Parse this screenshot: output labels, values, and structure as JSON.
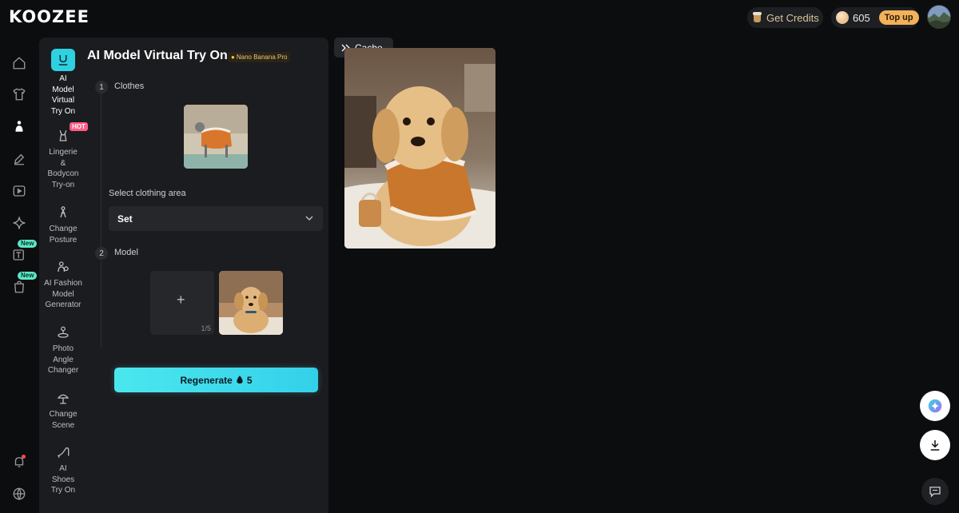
{
  "brand": {
    "logo_text": "KOOZEE"
  },
  "header": {
    "get_credits_label": "Get Credits",
    "credits_count": "605",
    "topup_label": "Top up"
  },
  "rail": {
    "new_badge": "New"
  },
  "tools": [
    {
      "label": "AI\nModel\nVirtual\nTry On"
    },
    {
      "label": "Lingerie\n&\nBodycon\nTry-on",
      "badge": "HOT"
    },
    {
      "label": "Change\nPosture"
    },
    {
      "label": "AI Fashion\nModel\nGenerator"
    },
    {
      "label": "Photo\nAngle\nChanger"
    },
    {
      "label": "Change\nScene"
    },
    {
      "label": "AI\nShoes\nTry On"
    }
  ],
  "panel": {
    "title": "AI Model Virtual Try On",
    "model_badge": "Nano Banana Pro",
    "steps": [
      {
        "num": "1",
        "label": "Clothes"
      },
      {
        "num": "2",
        "label": "Model"
      }
    ],
    "clothing_area_label": "Select clothing area",
    "clothing_area_value": "Set",
    "upload_plus": "+",
    "upload_count": "1/5",
    "regenerate_label": "Regenerate",
    "regenerate_cost": "5"
  },
  "result": {
    "cache_label": "Cache"
  }
}
